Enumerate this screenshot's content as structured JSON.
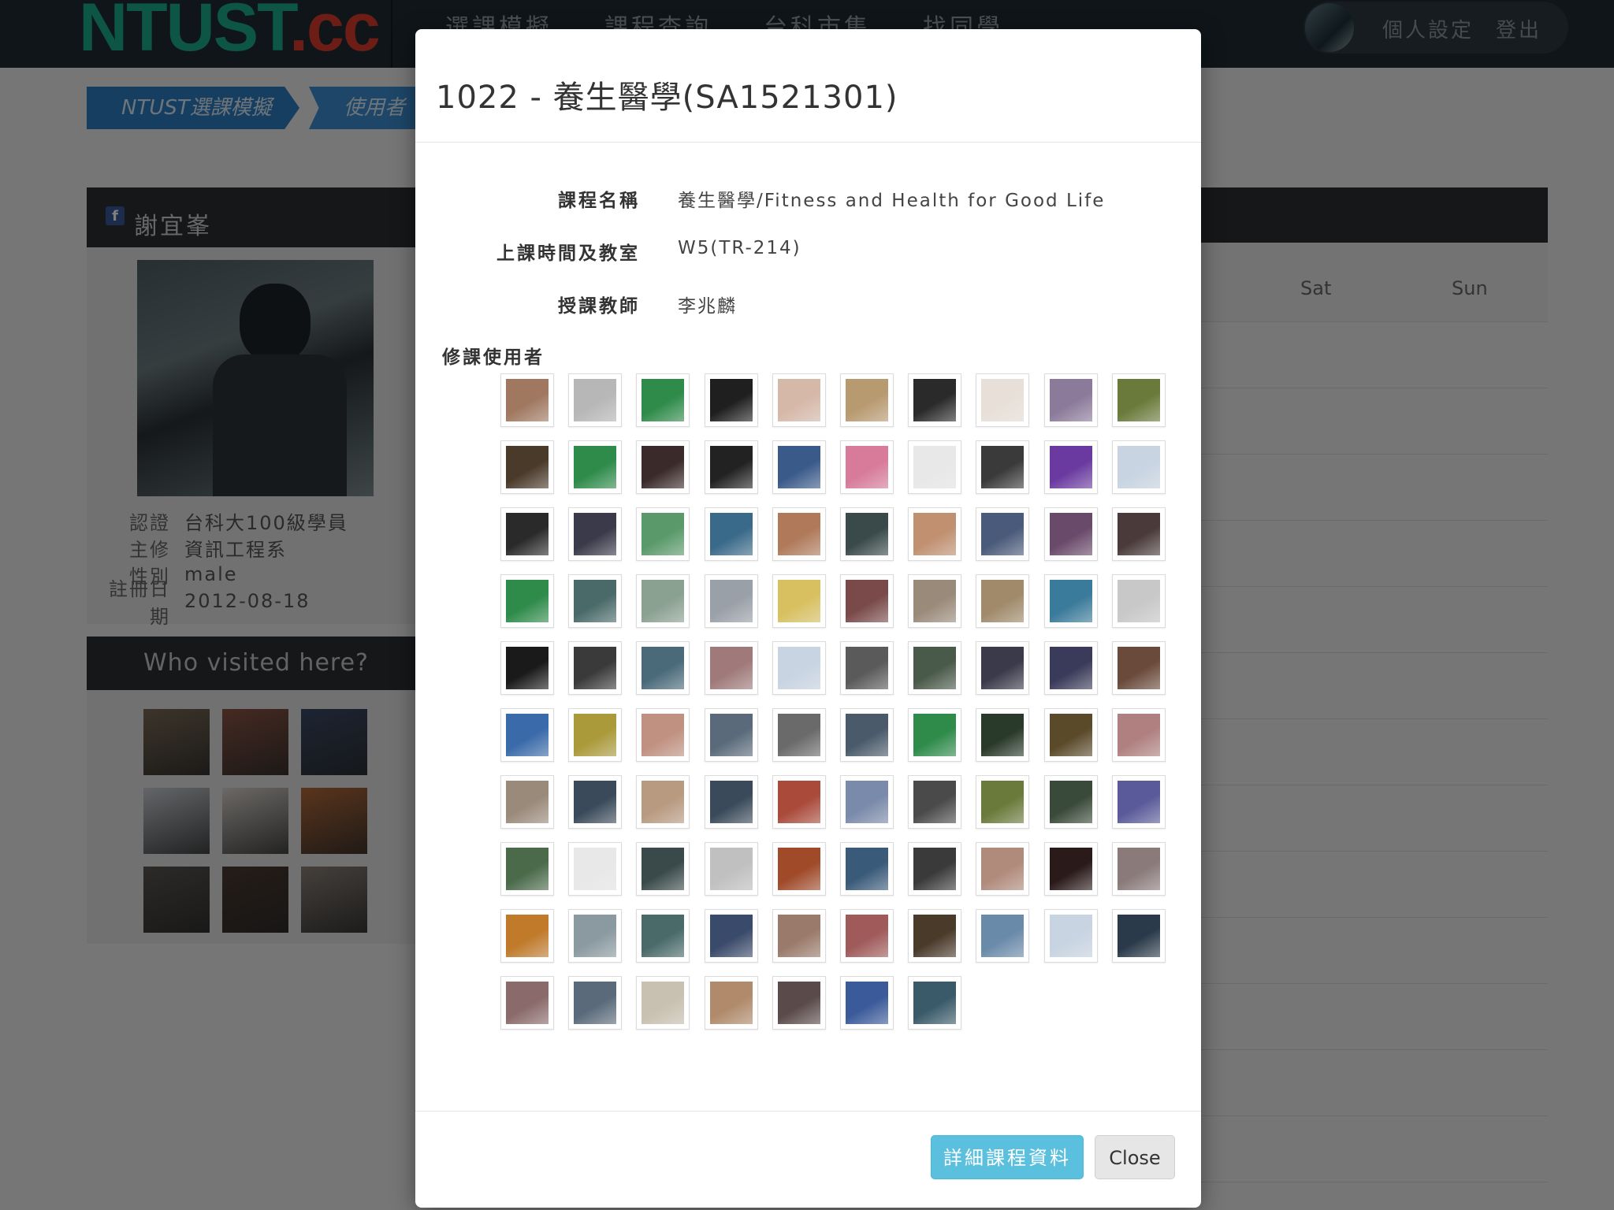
{
  "app": {
    "logo_main": "NTUST",
    "logo_suffix": ".cc",
    "nav": [
      "選課模擬",
      "課程查詢",
      "台科市集",
      "找同學"
    ],
    "user_links": [
      "個人設定",
      "登出"
    ]
  },
  "breadcrumb": [
    "NTUST選課模擬",
    "使用者"
  ],
  "profile": {
    "name": "謝宜峯",
    "fields": [
      {
        "key": "認證",
        "value": "台科大100級學員"
      },
      {
        "key": "主修",
        "value": "資訊工程系"
      },
      {
        "key": "性別",
        "value": "male"
      },
      {
        "key": "註冊日期",
        "value": "2012-08-18"
      }
    ]
  },
  "visitors": {
    "title": "Who visited here?",
    "avatars": [
      "#7a6a55",
      "#8a5544",
      "#3a4a66",
      "#c7ccd2",
      "#d8d2cc",
      "#b36a3a",
      "#5a5550",
      "#4a3a30",
      "#8a8078"
    ]
  },
  "timetable": {
    "days": [
      "Sat",
      "Sun"
    ]
  },
  "modal": {
    "title": "1022 - 養生醫學(SA1521301)",
    "fields": [
      {
        "label": "課程名稱",
        "value": "養生醫學/Fitness and Health for Good Life"
      },
      {
        "label": "上課時間及教室",
        "value": "W5(TR-214)"
      },
      {
        "label": "授課教師",
        "value": "李兆麟"
      }
    ],
    "users_label": "修課使用者",
    "user_avatars": [
      "#a07860",
      "#b7b7b7",
      "#2e8b4a",
      "#1f1f1f",
      "#d6b8a8",
      "#b89a70",
      "#2a2a2a",
      "#e8e0d8",
      "#8c7a9a",
      "#6a7a3a",
      "#4a3a2a",
      "#2e8b4a",
      "#3a2a2a",
      "#222222",
      "#3a5a8a",
      "#d87a9a",
      "#e8e8e8",
      "#3a3a3a",
      "#6a3aa0",
      "#c8d4e2",
      "#2a2a2a",
      "#3a3a4a",
      "#5a9a6a",
      "#3a6a8a",
      "#b07a5a",
      "#3a4a4a",
      "#c09070",
      "#4a5a7a",
      "#6a4a6a",
      "#4a3a3a",
      "#2e8b4a",
      "#4a6a6a",
      "#8aa090",
      "#9aa0a8",
      "#d8c060",
      "#7a4a4a",
      "#9a8a7a",
      "#a08a6a",
      "#3a7a9a",
      "#c8c8c8",
      "#1a1a1a",
      "#3a3a3a",
      "#4a6a7a",
      "#a07a7a",
      "#c8d4e2",
      "#5a5a5a",
      "#4a5a4a",
      "#3a3a4a",
      "#3a3a5a",
      "#6a4a3a",
      "#3a6aaa",
      "#aa9a3a",
      "#c09080",
      "#5a6a7a",
      "#6a6a6a",
      "#4a5a6a",
      "#2e8b4a",
      "#2a3a2a",
      "#5a4a2a",
      "#b08080",
      "#9a8a7a",
      "#3a4a5a",
      "#b89a80",
      "#3a4a5a",
      "#aa4a3a",
      "#7a8aaa",
      "#4a4a4a",
      "#6a7a3a",
      "#3a4a3a",
      "#5a5a9a",
      "#4a6a4a",
      "#e8e8e8",
      "#3a4a4a",
      "#c0c0c0",
      "#a04a2a",
      "#3a5a7a",
      "#3a3a3a",
      "#b08a7a",
      "#2a1a1a",
      "#8a7a7a",
      "#c07a2a",
      "#8a9aa0",
      "#4a6a6a",
      "#3a4a6a",
      "#9a7a6a",
      "#a05a5a",
      "#4a3a2a",
      "#6a8aaa",
      "#c8d4e2",
      "#2a3a4a",
      "#8a6a6a",
      "#5a6a7a",
      "#c8c0b0",
      "#b08a6a",
      "#5a4a4a",
      "#3a5a9a",
      "#3a5a6a"
    ],
    "detail_button": "詳細課程資料",
    "close_button": "Close"
  }
}
